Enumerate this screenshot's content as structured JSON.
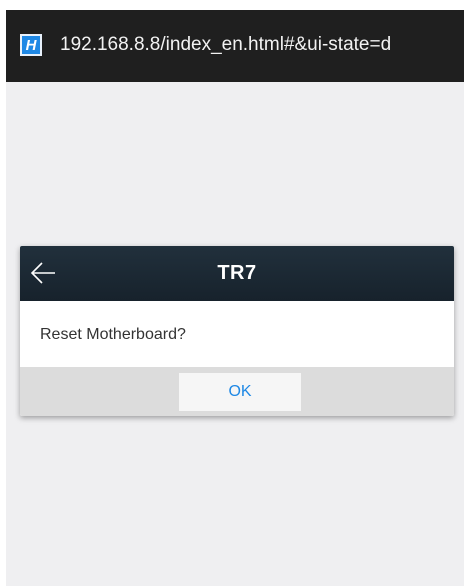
{
  "browser": {
    "app_icon_letter": "H",
    "url": "192.168.8.8/index_en.html#&ui-state=d"
  },
  "dialog": {
    "title": "TR7",
    "message": "Reset Motherboard?",
    "ok_label": "OK",
    "back_icon": "arrow-left-icon"
  },
  "colors": {
    "top_bar": "#1f1f1f",
    "page_background": "#efeff1",
    "dialog_header": "#1b2833",
    "footer": "#dcdcdc",
    "accent": "#1e88e5"
  }
}
